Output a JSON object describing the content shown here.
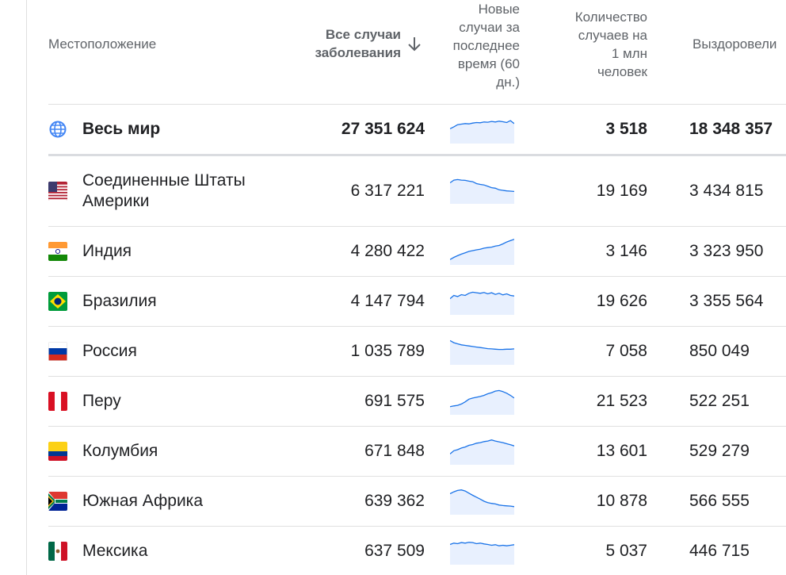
{
  "headers": {
    "location": "Местоположение",
    "total_line1": "Все случаи",
    "total_line2": "заболевания",
    "new_cases_lines": [
      "Новые",
      "случаи за",
      "последнее",
      "время (60",
      "дн.)"
    ],
    "per_million_lines": [
      "Количество",
      "случаев на",
      "1 млн",
      "человек"
    ],
    "recovered": "Выздоровели"
  },
  "sort_icon": "arrow-down-icon",
  "world": {
    "name": "Весь мир",
    "total": "27 351 624",
    "per_million": "3 518",
    "recovered": "18 348 357",
    "icon": "globe-icon",
    "trend": [
      0.55,
      0.62,
      0.7,
      0.72,
      0.74,
      0.73,
      0.76,
      0.78,
      0.77,
      0.8,
      0.79,
      0.82,
      0.8,
      0.83,
      0.81,
      0.78,
      0.85,
      0.74
    ]
  },
  "rows": [
    {
      "name_line1": "Соединенные Штаты",
      "name_line2": "Америки",
      "total": "6 317 221",
      "per_million": "19 169",
      "recovered": "3 434 815",
      "flag": "us-flag",
      "trend": [
        0.78,
        0.88,
        0.9,
        0.88,
        0.87,
        0.84,
        0.82,
        0.75,
        0.72,
        0.7,
        0.65,
        0.6,
        0.58,
        0.52,
        0.5,
        0.48,
        0.47,
        0.46
      ]
    },
    {
      "name_line1": "Индия",
      "name_line2": "",
      "total": "4 280 422",
      "per_million": "3 146",
      "recovered": "3 323 950",
      "flag": "india-flag",
      "trend": [
        0.2,
        0.28,
        0.34,
        0.4,
        0.45,
        0.5,
        0.53,
        0.56,
        0.58,
        0.62,
        0.64,
        0.66,
        0.7,
        0.72,
        0.78,
        0.85,
        0.9,
        0.95
      ]
    },
    {
      "name_line1": "Бразилия",
      "name_line2": "",
      "total": "4 147 794",
      "per_million": "19 626",
      "recovered": "3 355 564",
      "flag": "brazil-flag",
      "trend": [
        0.6,
        0.72,
        0.68,
        0.75,
        0.72,
        0.8,
        0.84,
        0.82,
        0.8,
        0.83,
        0.78,
        0.82,
        0.76,
        0.8,
        0.74,
        0.78,
        0.72,
        0.7
      ]
    },
    {
      "name_line1": "Россия",
      "name_line2": "",
      "total": "1 035 789",
      "per_million": "7 058",
      "recovered": "850 049",
      "flag": "russia-flag",
      "trend": [
        0.9,
        0.82,
        0.78,
        0.74,
        0.72,
        0.7,
        0.68,
        0.66,
        0.64,
        0.62,
        0.6,
        0.59,
        0.58,
        0.57,
        0.57,
        0.58,
        0.58,
        0.59
      ]
    },
    {
      "name_line1": "Перу",
      "name_line2": "",
      "total": "691 575",
      "per_million": "21 523",
      "recovered": "522 251",
      "flag": "peru-flag",
      "trend": [
        0.3,
        0.33,
        0.35,
        0.4,
        0.48,
        0.58,
        0.62,
        0.65,
        0.68,
        0.72,
        0.78,
        0.82,
        0.88,
        0.9,
        0.86,
        0.8,
        0.72,
        0.62
      ]
    },
    {
      "name_line1": "Колумбия",
      "name_line2": "",
      "total": "671 848",
      "per_million": "13 601",
      "recovered": "529 279",
      "flag": "colombia-flag",
      "trend": [
        0.4,
        0.52,
        0.56,
        0.62,
        0.66,
        0.72,
        0.75,
        0.8,
        0.82,
        0.86,
        0.88,
        0.92,
        0.88,
        0.85,
        0.82,
        0.78,
        0.74,
        0.7
      ]
    },
    {
      "name_line1": "Южная Африка",
      "name_line2": "",
      "total": "639 362",
      "per_million": "10 878",
      "recovered": "566 555",
      "flag": "south-africa-flag",
      "trend": [
        0.78,
        0.85,
        0.9,
        0.92,
        0.88,
        0.8,
        0.72,
        0.65,
        0.58,
        0.5,
        0.45,
        0.42,
        0.4,
        0.36,
        0.34,
        0.33,
        0.32,
        0.3
      ]
    },
    {
      "name_line1": "Мексика",
      "name_line2": "",
      "total": "637 509",
      "per_million": "5 037",
      "recovered": "446 715",
      "flag": "mexico-flag",
      "trend": [
        0.75,
        0.8,
        0.78,
        0.82,
        0.8,
        0.83,
        0.82,
        0.78,
        0.8,
        0.77,
        0.75,
        0.72,
        0.74,
        0.7,
        0.72,
        0.7,
        0.72,
        0.74
      ]
    }
  ],
  "colors": {
    "accent": "#4285f4",
    "fill": "#e8f0fe",
    "line": "#1a73e8",
    "text": "#202124",
    "muted": "#5f6368"
  }
}
